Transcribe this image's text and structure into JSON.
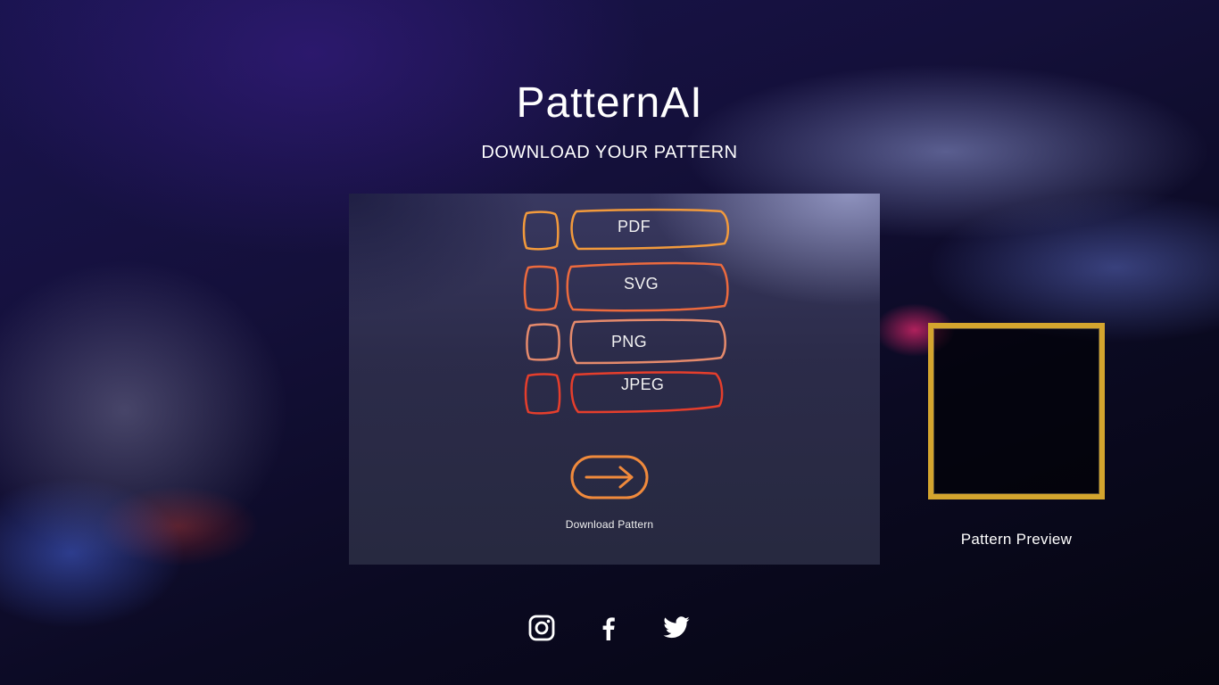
{
  "brand": {
    "title": "PatternAI",
    "subtitle": "DOWNLOAD YOUR PATTERN"
  },
  "formats": [
    {
      "label": "PDF",
      "color": "#f29a3c"
    },
    {
      "label": "SVG",
      "color": "#ec6a3e"
    },
    {
      "label": "PNG",
      "color": "#e58a6c"
    },
    {
      "label": "JPEG",
      "color": "#e53e2c"
    }
  ],
  "download": {
    "label": "Download Pattern",
    "icon": "arrow-right-icon",
    "color": "#f08a3c"
  },
  "preview": {
    "label": "Pattern Preview",
    "frame_color": "#d4a52e"
  },
  "social": [
    {
      "icon": "instagram-icon"
    },
    {
      "icon": "facebook-icon"
    },
    {
      "icon": "twitter-icon"
    }
  ]
}
